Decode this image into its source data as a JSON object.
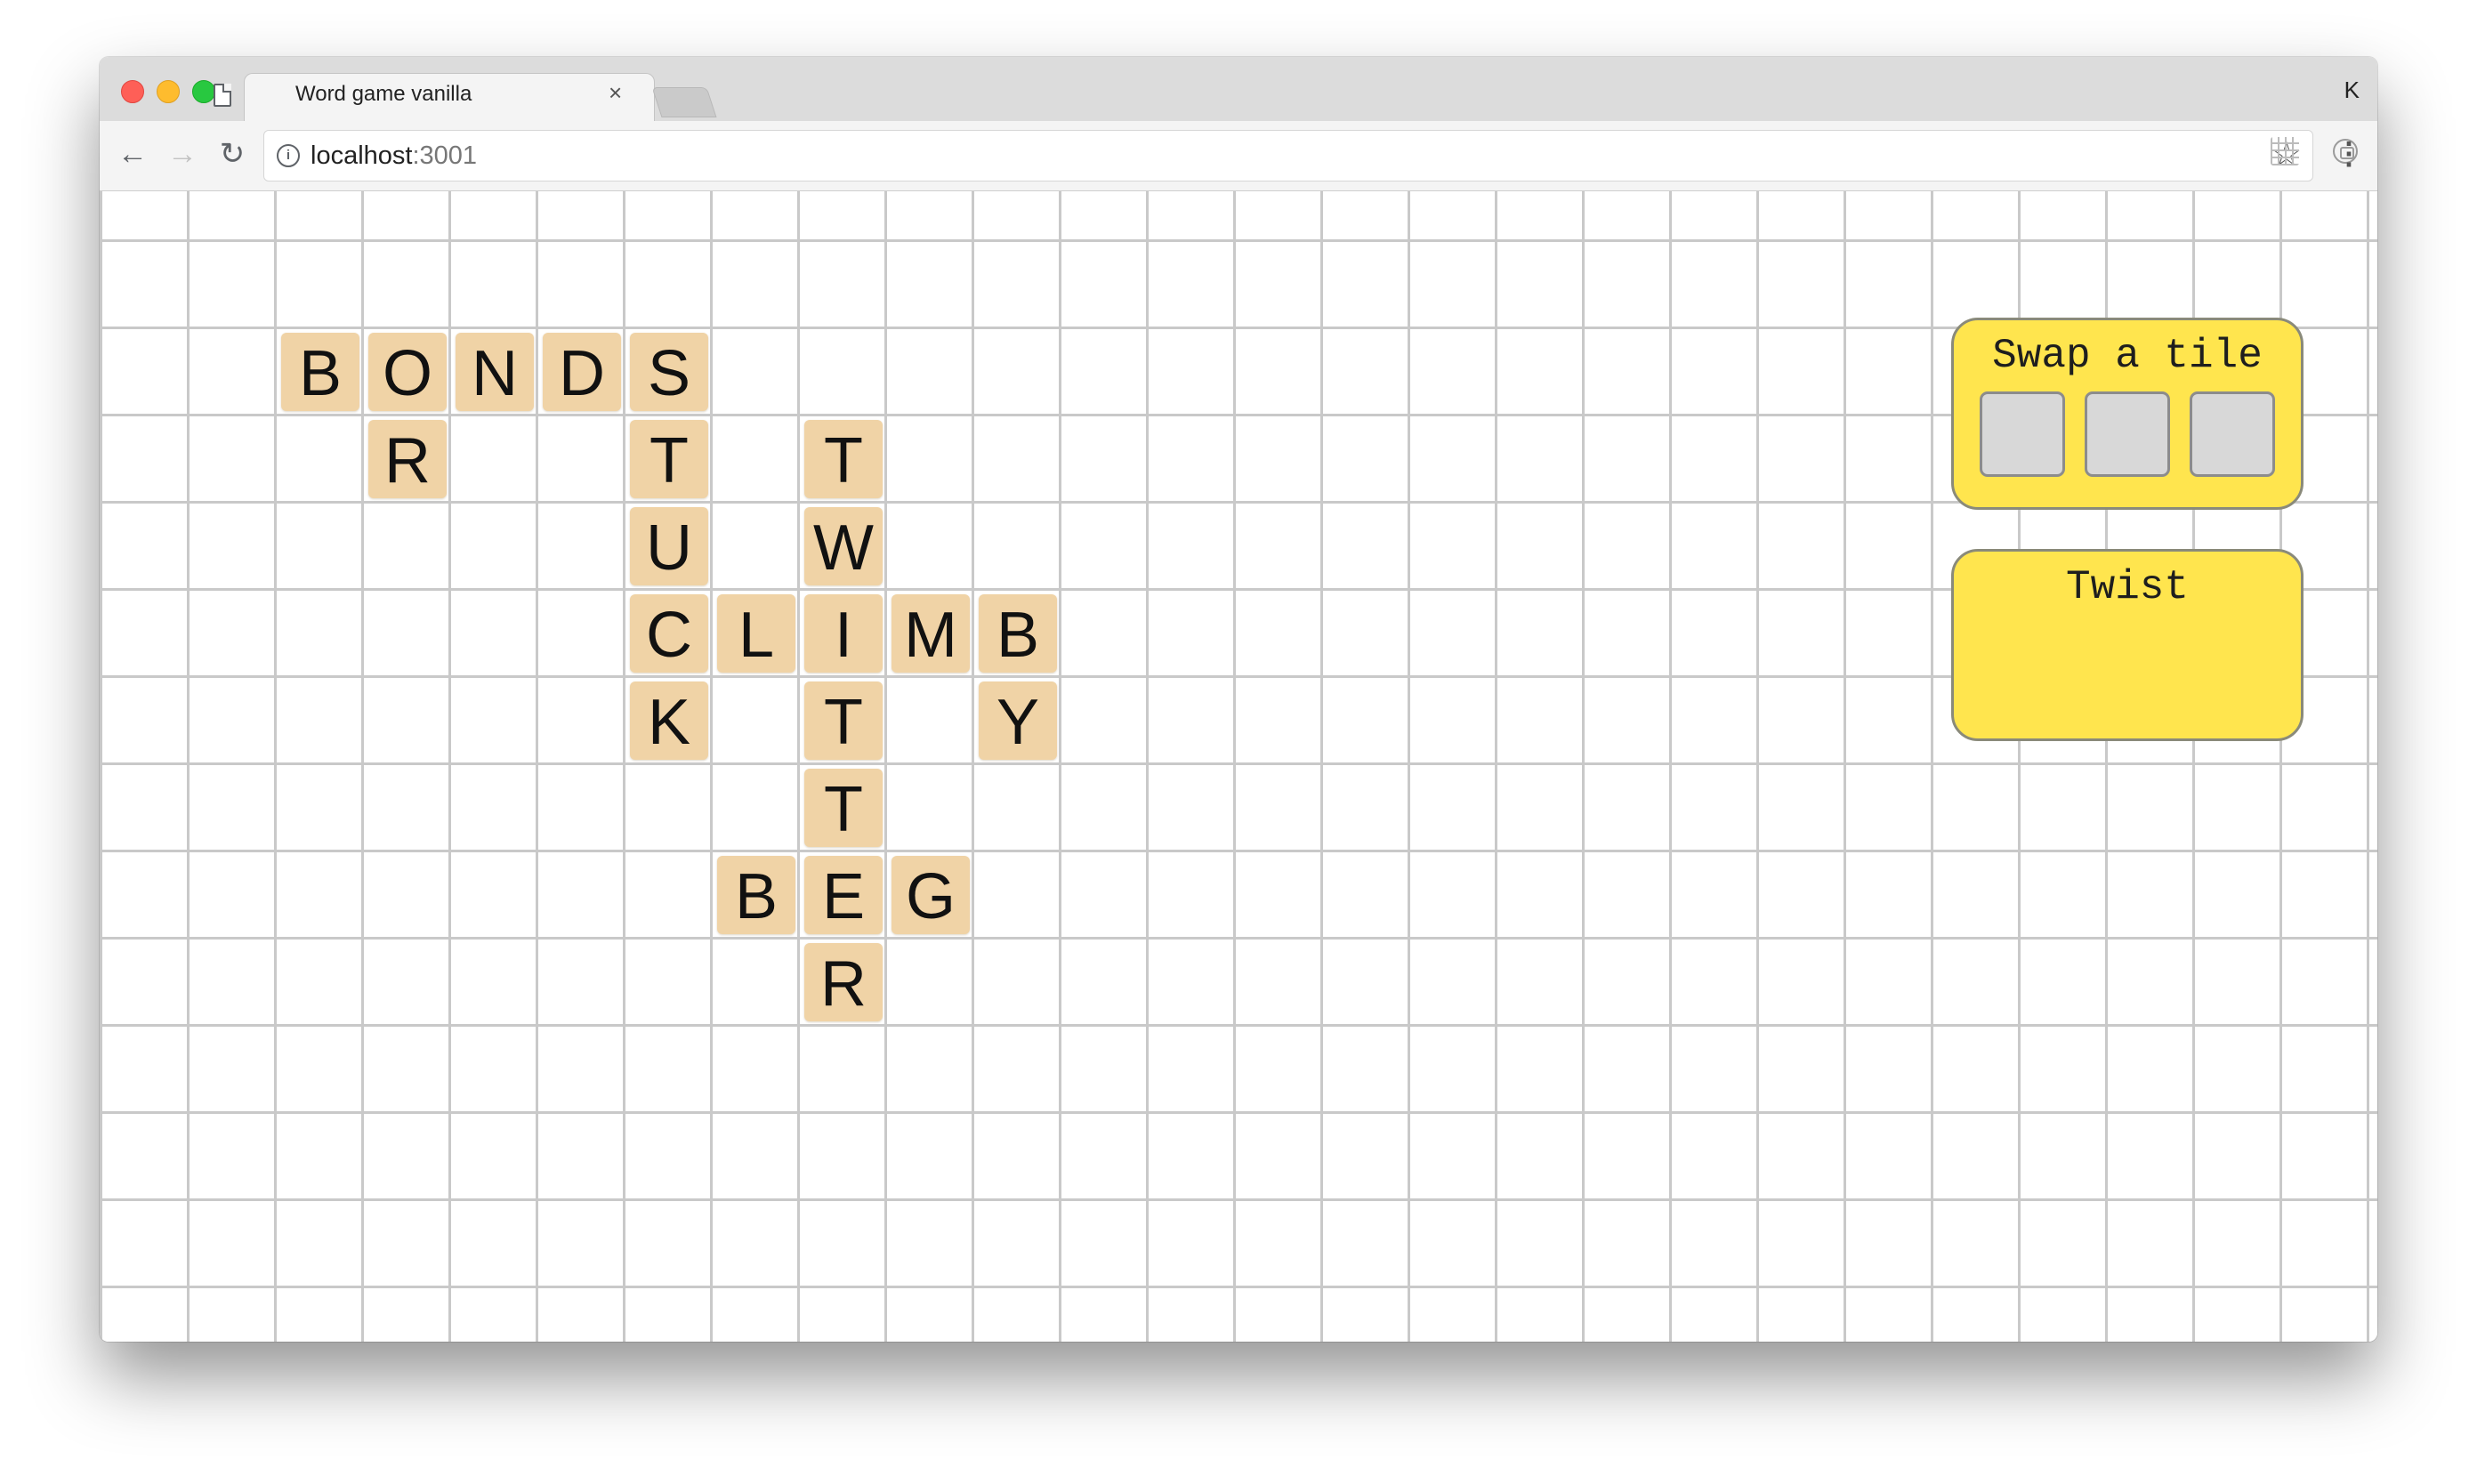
{
  "browser": {
    "tab_title": "Word game vanilla",
    "tab_close": "×",
    "profile": "K",
    "url_host": "localhost",
    "url_port": ":3001",
    "icons": {
      "back": "arrow-left",
      "forward": "arrow-right",
      "reload": "reload",
      "info": "info",
      "bookmark": "star",
      "menu": "vertical-dots"
    }
  },
  "colors": {
    "tile": "#f0d3a6",
    "panel": "#ffe54e",
    "slot": "#d8d8d8",
    "grid": "#c9c9c9"
  },
  "board": {
    "tiles": [
      {
        "letter": "B",
        "col": 2,
        "row": 2
      },
      {
        "letter": "O",
        "col": 3,
        "row": 2
      },
      {
        "letter": "N",
        "col": 4,
        "row": 2
      },
      {
        "letter": "D",
        "col": 5,
        "row": 2
      },
      {
        "letter": "S",
        "col": 6,
        "row": 2
      },
      {
        "letter": "R",
        "col": 3,
        "row": 3
      },
      {
        "letter": "T",
        "col": 6,
        "row": 3
      },
      {
        "letter": "T",
        "col": 8,
        "row": 3
      },
      {
        "letter": "U",
        "col": 6,
        "row": 4
      },
      {
        "letter": "W",
        "col": 8,
        "row": 4
      },
      {
        "letter": "C",
        "col": 6,
        "row": 5
      },
      {
        "letter": "L",
        "col": 7,
        "row": 5
      },
      {
        "letter": "I",
        "col": 8,
        "row": 5
      },
      {
        "letter": "M",
        "col": 9,
        "row": 5
      },
      {
        "letter": "B",
        "col": 10,
        "row": 5
      },
      {
        "letter": "K",
        "col": 6,
        "row": 6
      },
      {
        "letter": "T",
        "col": 8,
        "row": 6
      },
      {
        "letter": "Y",
        "col": 10,
        "row": 6
      },
      {
        "letter": "T",
        "col": 8,
        "row": 7
      },
      {
        "letter": "B",
        "col": 7,
        "row": 8
      },
      {
        "letter": "E",
        "col": 8,
        "row": 8
      },
      {
        "letter": "G",
        "col": 9,
        "row": 8
      },
      {
        "letter": "R",
        "col": 8,
        "row": 9
      }
    ]
  },
  "panels": {
    "swap_title": "Swap a tile",
    "swap_slots": 3,
    "twist_title": "Twist"
  }
}
